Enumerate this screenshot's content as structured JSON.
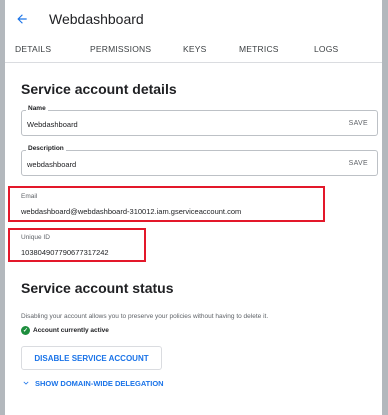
{
  "header": {
    "title": "Webdashboard"
  },
  "tabs": [
    {
      "label": "DETAILS"
    },
    {
      "label": "PERMISSIONS"
    },
    {
      "label": "KEYS"
    },
    {
      "label": "METRICS"
    },
    {
      "label": "LOGS"
    }
  ],
  "details": {
    "title": "Service account details",
    "name": {
      "label": "Name",
      "value": "Webdashboard",
      "save": "SAVE"
    },
    "description": {
      "label": "Description",
      "value": "webdashboard",
      "save": "SAVE"
    },
    "email": {
      "label": "Email",
      "value": "webdashboard@webdashboard-310012.iam.gserviceaccount.com"
    },
    "unique_id": {
      "label": "Unique ID",
      "value": "103804907790677317242"
    }
  },
  "status": {
    "title": "Service account status",
    "description": "Disabling your account allows you to preserve your policies without having to delete it.",
    "active_text": "Account currently active",
    "disable_button": "DISABLE SERVICE ACCOUNT"
  },
  "delegation": {
    "label": "SHOW DOMAIN-WIDE DELEGATION"
  },
  "colors": {
    "accent": "#1a73e8",
    "highlight": "#e3182a",
    "success": "#1e8e3e"
  },
  "icons": {
    "back": "arrow-back-icon",
    "check": "check-circle-icon",
    "expand": "chevron-down-icon"
  }
}
